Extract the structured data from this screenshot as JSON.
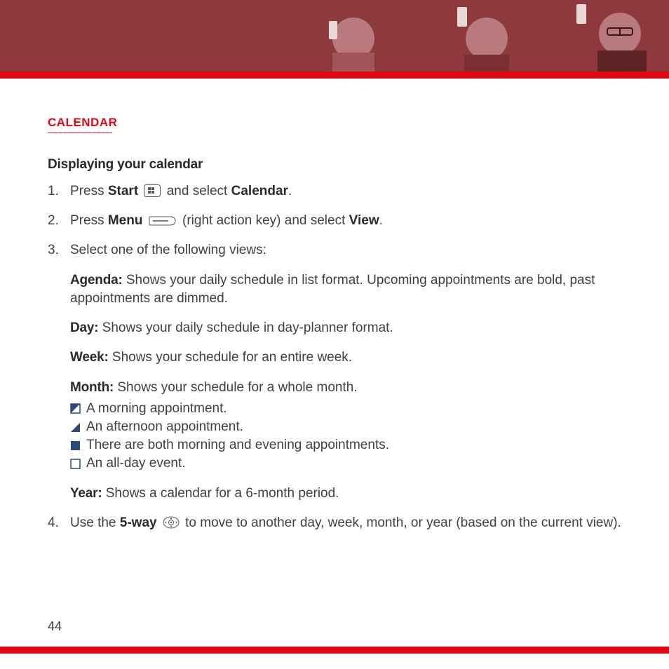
{
  "section_title": "CALENDAR",
  "subheading": "Displaying your calendar",
  "step1": {
    "t1": "Press ",
    "b1": "Start",
    "t2": " and select ",
    "b2": "Calendar",
    "t3": "."
  },
  "step2": {
    "t1": "Press ",
    "b1": "Menu",
    "t2": " (right action key) and select ",
    "b2": "View",
    "t3": "."
  },
  "step3": {
    "intro": "Select one of the following views:",
    "agenda_label": "Agenda:",
    "agenda_text": " Shows your daily schedule in list format. Upcoming appointments are bold, past appointments are dimmed.",
    "day_label": "Day:",
    "day_text": " Shows your daily schedule in day-planner format.",
    "week_label": "Week:",
    "week_text": " Shows your schedule for an entire week.",
    "month_label": "Month:",
    "month_text": " Shows your schedule for a whole month.",
    "legend_morning": "A morning appointment.",
    "legend_afternoon": "An afternoon appointment.",
    "legend_both": "There are both morning and evening appointments.",
    "legend_allday": "An all-day event.",
    "year_label": "Year:",
    "year_text": " Shows a calendar for a 6-month period."
  },
  "step4": {
    "t1": "Use the ",
    "b1": "5-way",
    "t2": " to move to another day, week, month, or year (based on the current view)."
  },
  "page_number": "44"
}
